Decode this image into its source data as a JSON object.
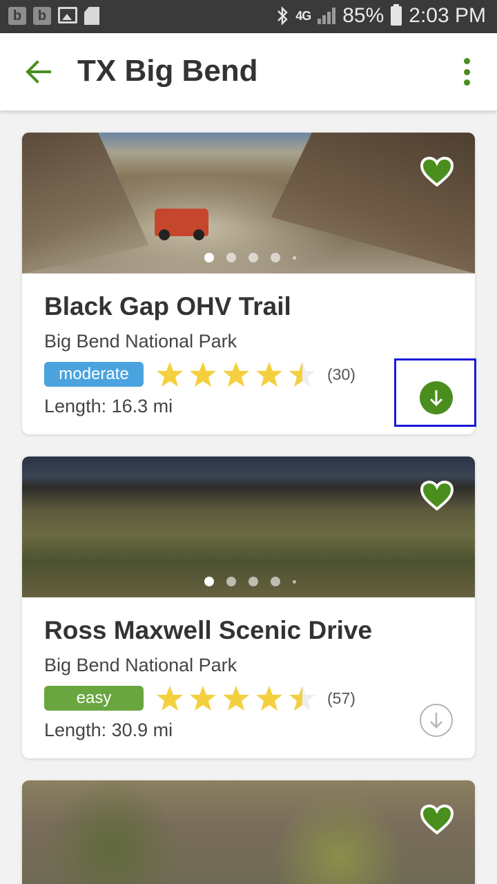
{
  "status_bar": {
    "left_icons": [
      "b",
      "b",
      "image-icon",
      "sd-card-icon"
    ],
    "network": "4G",
    "battery": "85%",
    "time": "2:03 PM"
  },
  "app_bar": {
    "title": "TX Big Bend"
  },
  "colors": {
    "brand_green": "#4a8e1e",
    "moderate": "#4aa3df",
    "easy": "#6aa640",
    "star": "#f4d03f"
  },
  "trails": [
    {
      "name": "Black Gap OHV Trail",
      "park": "Big Bend National Park",
      "difficulty": "moderate",
      "rating": 4.5,
      "reviews": "(30)",
      "length": "Length: 16.3 mi",
      "downloaded": true,
      "favorite": true,
      "photo_count": 5,
      "photo_index": 1
    },
    {
      "name": "Ross Maxwell Scenic Drive",
      "park": "Big Bend National Park",
      "difficulty": "easy",
      "rating": 4.5,
      "reviews": "(57)",
      "length": "Length: 30.9 mi",
      "downloaded": false,
      "favorite": true,
      "photo_count": 5,
      "photo_index": 1
    }
  ]
}
